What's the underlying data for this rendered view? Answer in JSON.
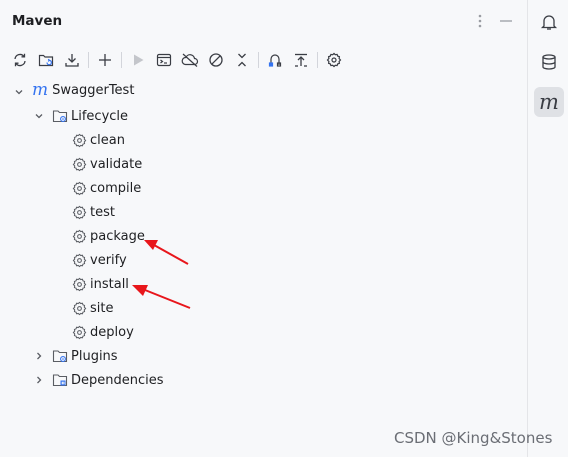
{
  "panel": {
    "title": "Maven",
    "header_icons": [
      "more-vert-icon",
      "minimize-icon"
    ]
  },
  "toolbar": {
    "buttons": [
      {
        "name": "reload-icon"
      },
      {
        "name": "add-maven-project-icon"
      },
      {
        "name": "download-sources-icon"
      },
      {
        "name": "add-icon"
      },
      {
        "name": "run-icon"
      },
      {
        "name": "execute-goal-icon"
      },
      {
        "name": "offline-mode-icon"
      },
      {
        "name": "skip-tests-icon"
      },
      {
        "name": "collapse-all-icon"
      },
      {
        "name": "show-dependencies-icon"
      },
      {
        "name": "collapse-top-icon"
      },
      {
        "name": "settings-icon"
      }
    ]
  },
  "tree": {
    "project": "SwaggerTest",
    "lifecycle": {
      "label": "Lifecycle",
      "goals": [
        "clean",
        "validate",
        "compile",
        "test",
        "package",
        "verify",
        "install",
        "site",
        "deploy"
      ]
    },
    "plugins": "Plugins",
    "dependencies": "Dependencies"
  },
  "rightbar": {
    "items": [
      "notifications-icon",
      "database-icon",
      "maven-icon"
    ],
    "active": "maven-icon",
    "maven_glyph": "m"
  },
  "annotations": {
    "arrow_color": "#e8161b",
    "arrow_targets": [
      "package",
      "install"
    ]
  },
  "watermark": "CSDN @King&Stones"
}
